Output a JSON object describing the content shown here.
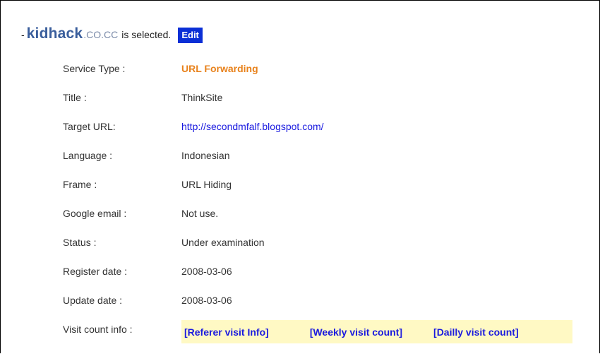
{
  "header": {
    "dash": "-",
    "domain_name": "kidhack",
    "domain_suffix": ".CO.CC",
    "selected_text": "is selected.",
    "edit_label": "Edit"
  },
  "fields": {
    "service_type": {
      "label": "Service Type :",
      "value": "URL Forwarding"
    },
    "title": {
      "label": "Title :",
      "value": "ThinkSite"
    },
    "target_url": {
      "label": "Target URL:",
      "value": "http://secondmfalf.blogspot.com/"
    },
    "language": {
      "label": "Language :",
      "value": "Indonesian"
    },
    "frame": {
      "label": "Frame :",
      "value": "URL Hiding"
    },
    "google_email": {
      "label": "Google email :",
      "value": "Not use."
    },
    "status": {
      "label": "Status :",
      "value": "Under examination"
    },
    "register_date": {
      "label": "Register date :",
      "value": "2008-03-06"
    },
    "update_date": {
      "label": "Update date :",
      "value": "2008-03-06"
    },
    "visit_count": {
      "label": "Visit count info :",
      "referer_link": "[Referer visit Info]",
      "weekly_link": "[Weekly visit count]",
      "daily_link": "[Dailly visit count]"
    }
  },
  "colors": {
    "domain_name": "#3a5e9c",
    "edit_button_bg": "#0b2fd6",
    "service_type_value": "#e8821c",
    "link": "#1a1adf",
    "visit_bar_bg": "#fff9c4"
  }
}
